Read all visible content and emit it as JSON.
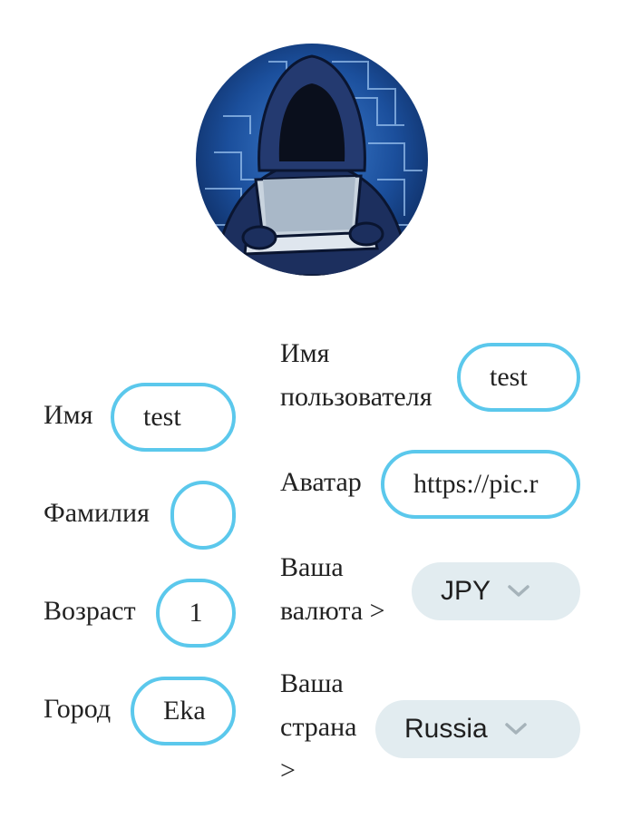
{
  "avatar": {
    "alt": "hacker-avatar"
  },
  "left_form": {
    "first_name": {
      "label": "Имя",
      "value": "test"
    },
    "last_name": {
      "label": "Фамилия",
      "value": ""
    },
    "age": {
      "label": "Возраст",
      "value": "1"
    },
    "city": {
      "label": "Город",
      "value": "Eka"
    }
  },
  "right_form": {
    "username": {
      "label_line1": "Имя",
      "label_line2": "пользователя",
      "value": "test"
    },
    "avatar_url": {
      "label": "Аватар",
      "value": "https://pic.r"
    },
    "currency": {
      "label_line1": "Ваша",
      "label_line2": "валюта >",
      "value": "JPY"
    },
    "country": {
      "label_line1": "Ваша",
      "label_line2": "страна",
      "label_line3": ">",
      "value": "Russia"
    }
  },
  "colors": {
    "accent": "#5bc8ec",
    "select_bg": "#e2ecf0",
    "avatar_bg": "#1b4f9c"
  }
}
